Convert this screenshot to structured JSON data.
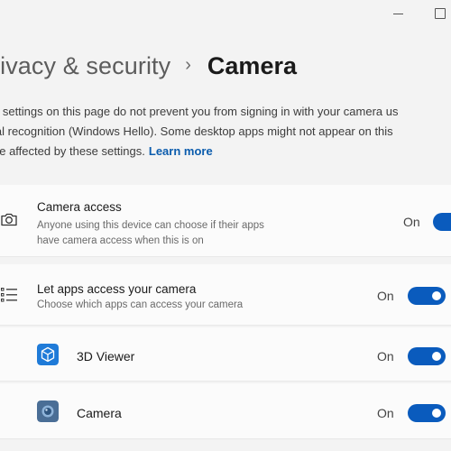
{
  "window": {
    "minimize_icon": "minimize-icon",
    "maximize_icon": "maximize-icon"
  },
  "header": {
    "parent": "rivacy & security",
    "separator": "›",
    "current": "Camera"
  },
  "description": {
    "line1": "e settings on this page do not prevent you from signing in with your camera us",
    "line2": "ial recognition (Windows Hello). Some desktop apps might not appear on this",
    "line3": "be affected by these settings.",
    "learn_more": "Learn more"
  },
  "camera_access": {
    "icon": "camera-icon",
    "title": "Camera access",
    "subtitle_line1": "Anyone using this device can choose if their apps",
    "subtitle_line2": "have camera access when this is on",
    "toggle_label": "On",
    "toggle_on": true
  },
  "let_apps": {
    "icon": "app-list-icon",
    "title": "Let apps access your camera",
    "subtitle": "Choose which apps can access your camera",
    "toggle_label": "On",
    "toggle_on": true
  },
  "apps": [
    {
      "name": "3D Viewer",
      "icon": "3d-viewer-icon",
      "toggle_label": "On",
      "toggle_on": true
    },
    {
      "name": "Camera",
      "icon": "camera-app-icon",
      "toggle_label": "On",
      "toggle_on": true
    }
  ],
  "colors": {
    "accent": "#0a5bbd",
    "link": "#0b5cad",
    "background": "#f3f3f3",
    "card": "#fbfbfb"
  }
}
